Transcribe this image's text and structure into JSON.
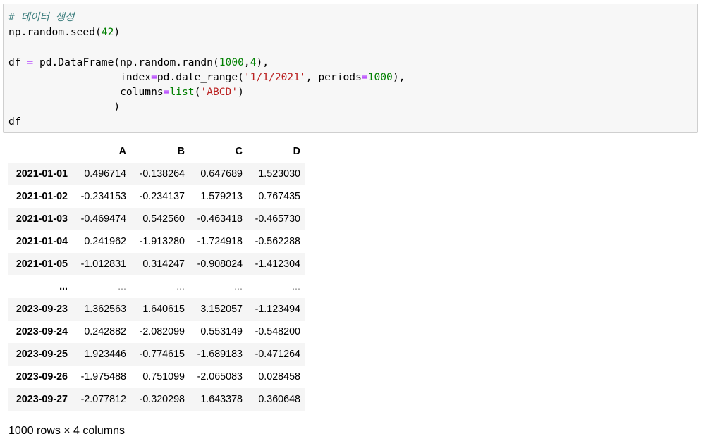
{
  "code_cell": {
    "lines": [
      [
        {
          "t": "# 데이터 생성",
          "c": "cm"
        }
      ],
      [
        {
          "t": "np.random.seed(",
          "c": ""
        },
        {
          "t": "42",
          "c": "num"
        },
        {
          "t": ")",
          "c": ""
        }
      ],
      [],
      [
        {
          "t": "df ",
          "c": ""
        },
        {
          "t": "=",
          "c": "op"
        },
        {
          "t": " pd.DataFrame(np.random.randn(",
          "c": ""
        },
        {
          "t": "1000",
          "c": "num"
        },
        {
          "t": ",",
          "c": ""
        },
        {
          "t": "4",
          "c": "num"
        },
        {
          "t": "),",
          "c": ""
        }
      ],
      [
        {
          "t": "                  index",
          "c": ""
        },
        {
          "t": "=",
          "c": "op"
        },
        {
          "t": "pd.date_range(",
          "c": ""
        },
        {
          "t": "'1/1/2021'",
          "c": "str"
        },
        {
          "t": ", periods",
          "c": ""
        },
        {
          "t": "=",
          "c": "op"
        },
        {
          "t": "1000",
          "c": "num"
        },
        {
          "t": "),",
          "c": ""
        }
      ],
      [
        {
          "t": "                  columns",
          "c": ""
        },
        {
          "t": "=",
          "c": "op"
        },
        {
          "t": "list",
          "c": "bi"
        },
        {
          "t": "(",
          "c": ""
        },
        {
          "t": "'ABCD'",
          "c": "str"
        },
        {
          "t": ")",
          "c": ""
        }
      ],
      [
        {
          "t": "                 )",
          "c": ""
        }
      ],
      [
        {
          "t": "df",
          "c": ""
        }
      ]
    ]
  },
  "dataframe": {
    "columns": [
      "A",
      "B",
      "C",
      "D"
    ],
    "rows": [
      {
        "index": "2021-01-01",
        "values": [
          "0.496714",
          "-0.138264",
          "0.647689",
          "1.523030"
        ]
      },
      {
        "index": "2021-01-02",
        "values": [
          "-0.234153",
          "-0.234137",
          "1.579213",
          "0.767435"
        ]
      },
      {
        "index": "2021-01-03",
        "values": [
          "-0.469474",
          "0.542560",
          "-0.463418",
          "-0.465730"
        ]
      },
      {
        "index": "2021-01-04",
        "values": [
          "0.241962",
          "-1.913280",
          "-1.724918",
          "-0.562288"
        ]
      },
      {
        "index": "2021-01-05",
        "values": [
          "-1.012831",
          "0.314247",
          "-0.908024",
          "-1.412304"
        ]
      },
      {
        "index": "...",
        "values": [
          "...",
          "...",
          "...",
          "..."
        ],
        "ellipsis": true
      },
      {
        "index": "2023-09-23",
        "values": [
          "1.362563",
          "1.640615",
          "3.152057",
          "-1.123494"
        ]
      },
      {
        "index": "2023-09-24",
        "values": [
          "0.242882",
          "-2.082099",
          "0.553149",
          "-0.548200"
        ]
      },
      {
        "index": "2023-09-25",
        "values": [
          "1.923446",
          "-0.774615",
          "-1.689183",
          "-0.471264"
        ]
      },
      {
        "index": "2023-09-26",
        "values": [
          "-1.975488",
          "0.751099",
          "-2.065083",
          "0.028458"
        ]
      },
      {
        "index": "2023-09-27",
        "values": [
          "-2.077812",
          "-0.320298",
          "1.643378",
          "0.360648"
        ]
      }
    ],
    "shape_text": "1000 rows × 4 columns"
  }
}
